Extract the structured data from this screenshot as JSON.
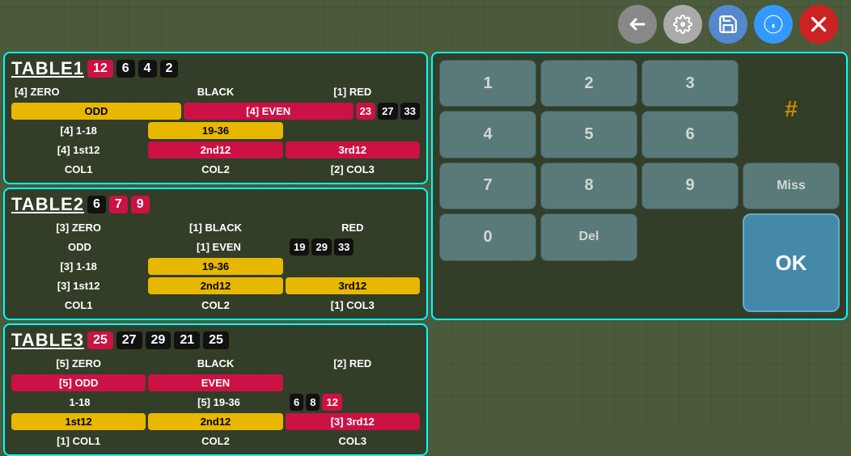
{
  "toolbar": {
    "back_label": "↩",
    "settings_label": "🔧",
    "save_label": "💾",
    "info_label": "ℹ",
    "close_label": "✖"
  },
  "table1": {
    "title": "TABLE1",
    "header_nums": [
      "12",
      "6",
      "4",
      "2"
    ],
    "header_colors": [
      "red",
      "black",
      "black",
      "black"
    ],
    "rows": [
      {
        "cols": [
          "[4] ZERO",
          "BLACK",
          "[1] RED"
        ]
      },
      {
        "cols": [
          "ODD",
          "[4] EVEN",
          ""
        ],
        "styles": [
          "yellow",
          "red",
          ""
        ],
        "extra": [
          "23",
          "27",
          "33"
        ]
      },
      {
        "cols": [
          "[4] 1-18",
          "19-36",
          ""
        ],
        "styles": [
          "",
          "yellow",
          ""
        ],
        "extra": []
      },
      {
        "cols": [
          "[4] 1st12",
          "2nd12",
          "3rd12"
        ],
        "styles": [
          "",
          "red",
          "red"
        ]
      },
      {
        "cols": [
          "COL1",
          "COL2",
          "[2] COL3"
        ]
      }
    ]
  },
  "table2": {
    "title": "TABLE2",
    "header_nums": [
      "6",
      "7",
      "9"
    ],
    "header_colors": [
      "black",
      "red",
      "red"
    ],
    "rows": [
      {
        "cols": [
          "[3] ZERO",
          "[1] BLACK",
          "RED"
        ]
      },
      {
        "cols": [
          "ODD",
          "[1] EVEN",
          ""
        ],
        "extra": [
          "19",
          "29",
          "33"
        ]
      },
      {
        "cols": [
          "[3] 1-18",
          "19-36",
          ""
        ],
        "styles": [
          "",
          "yellow",
          ""
        ]
      },
      {
        "cols": [
          "[3] 1st12",
          "2nd12",
          "3rd12"
        ],
        "styles": [
          "",
          "yellow",
          "yellow"
        ]
      },
      {
        "cols": [
          "COL1",
          "COL2",
          "[1] COL3"
        ]
      }
    ]
  },
  "table3": {
    "title": "TABLE3",
    "header_nums": [
      "25",
      "27",
      "29",
      "21",
      "25"
    ],
    "header_colors": [
      "red",
      "black",
      "black",
      "black",
      "black"
    ],
    "rows": [
      {
        "cols": [
          "[5] ZERO",
          "BLACK",
          "[2] RED"
        ]
      },
      {
        "cols": [
          "[5] ODD",
          "EVEN",
          ""
        ],
        "styles": [
          "red",
          "red",
          ""
        ]
      },
      {
        "cols": [
          "1-18",
          "[5] 19-36",
          ""
        ],
        "extra": [
          "6",
          "8",
          "12"
        ]
      },
      {
        "cols": [
          "1st12",
          "2nd12",
          "[3] 3rd12"
        ],
        "styles": [
          "yellow",
          "yellow",
          "red"
        ]
      },
      {
        "cols": [
          "[1] COL1",
          "COL2",
          "COL3"
        ]
      }
    ]
  },
  "numpad": {
    "buttons": [
      "1",
      "2",
      "3",
      "4",
      "5",
      "6",
      "7",
      "8",
      "9",
      "Miss",
      "0",
      "Del"
    ],
    "hash": "#",
    "ok": "OK"
  }
}
